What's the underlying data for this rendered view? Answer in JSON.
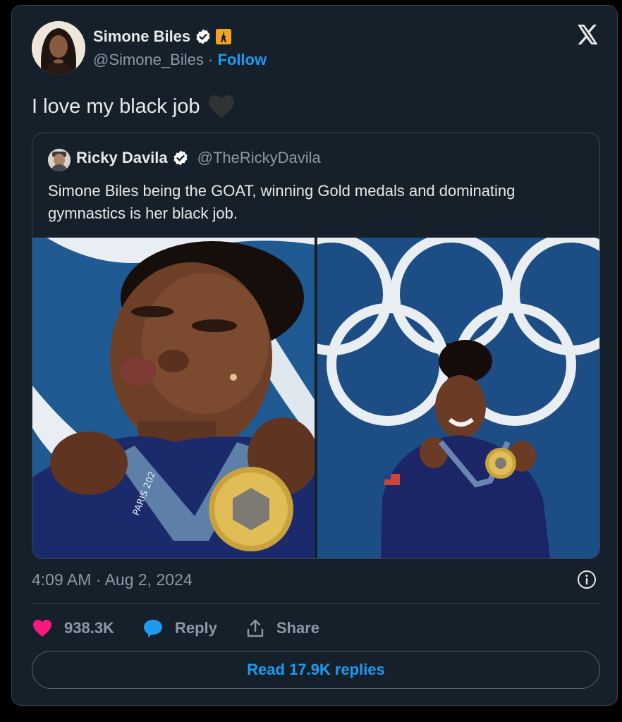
{
  "author": {
    "name": "Simone Biles",
    "handle": "@Simone_Biles",
    "separator": "·",
    "follow_label": "Follow",
    "badge_emoji": "🗼"
  },
  "tweet": {
    "text": "I love my black job",
    "emoji": "black-heart",
    "timestamp": "4:09 AM · Aug 2, 2024"
  },
  "quoted": {
    "name": "Ricky Davila",
    "handle": "@TheRickyDavila",
    "text": "Simone Biles being the GOAT, winning Gold medals and dominating gymnastics is her black job."
  },
  "images": {
    "left_lanyard_text": "PARIS 202"
  },
  "actions": {
    "likes": "938.3K",
    "reply_label": "Reply",
    "share_label": "Share"
  },
  "read_replies_label": "Read 17.9K replies",
  "colors": {
    "background": "#15202b",
    "accent": "#1d9bf0",
    "like": "#f91880",
    "muted": "#8b98a5"
  }
}
